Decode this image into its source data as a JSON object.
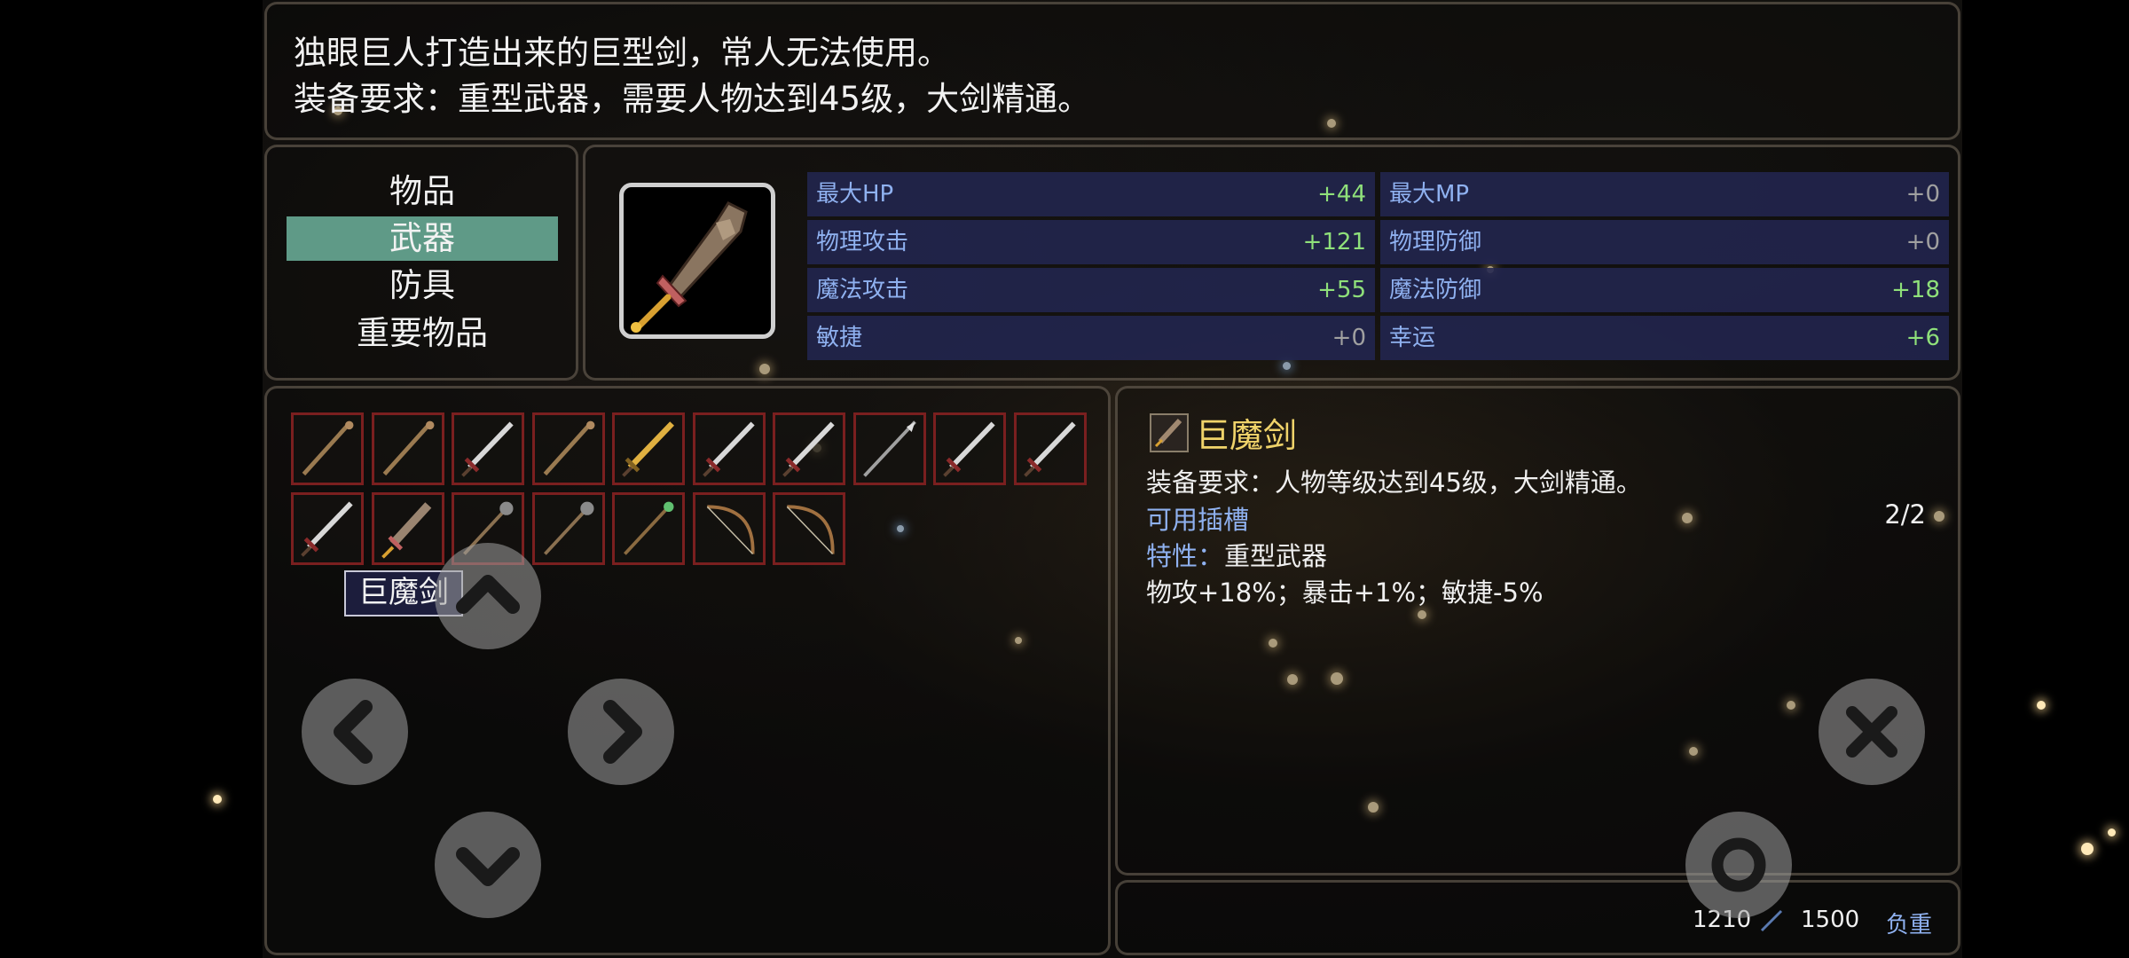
{
  "description": {
    "line1": "独眼巨人打造出来的巨型剑，常人无法使用。",
    "line2": "装备要求：重型武器，需要人物达到45级，大剑精通。"
  },
  "categories": [
    {
      "label": "物品",
      "active": false
    },
    {
      "label": "武器",
      "active": true
    },
    {
      "label": "防具",
      "active": false
    },
    {
      "label": "重要物品",
      "active": false
    }
  ],
  "stats": [
    {
      "left_label": "最大HP",
      "left_value": "+44",
      "right_label": "最大MP",
      "right_value": "+0"
    },
    {
      "left_label": "物理攻击",
      "left_value": "+121",
      "right_label": "物理防御",
      "right_value": "+0"
    },
    {
      "left_label": "魔法攻击",
      "left_value": "+55",
      "right_label": "魔法防御",
      "right_value": "+18"
    },
    {
      "left_label": "敏捷",
      "left_value": "+0",
      "right_label": "幸运",
      "right_value": "+6"
    }
  ],
  "inventory": {
    "items": [
      {
        "icon": "staff-icon"
      },
      {
        "icon": "staff-icon"
      },
      {
        "icon": "sword-icon"
      },
      {
        "icon": "staff-icon"
      },
      {
        "icon": "golden-sword-icon"
      },
      {
        "icon": "sword-icon"
      },
      {
        "icon": "sword-icon"
      },
      {
        "icon": "spear-icon"
      },
      {
        "icon": "sword-icon"
      },
      {
        "icon": "sword-icon"
      },
      {
        "icon": "sword-icon"
      },
      {
        "icon": "greatsword-icon"
      },
      {
        "icon": "mace-icon"
      },
      {
        "icon": "mace-icon"
      },
      {
        "icon": "gem-staff-icon"
      },
      {
        "icon": "bow-icon"
      },
      {
        "icon": "bow-icon"
      }
    ],
    "selected_tooltip": "巨魔剑"
  },
  "detail": {
    "name": "巨魔剑",
    "requirement": "装备要求：人物等级达到45级，大剑精通。",
    "slots_label": "可用插槽",
    "slots_value": "2/2",
    "trait_label": "特性：",
    "trait_value": "重型武器",
    "effects": "物攻+18%；暴击+1%；敏捷-5%"
  },
  "weight": {
    "current": "1210",
    "max": "1500",
    "label": "负重"
  },
  "colors": {
    "active_tab": "#5f9a87",
    "stat_row": "#222650",
    "positive": "#8fe07a",
    "stat_label": "#8fb1f0",
    "item_name": "#f0d36a",
    "slot_border": "#7a1f1f"
  },
  "controls": {
    "up": "chevron-up-icon",
    "left": "chevron-left-icon",
    "right": "chevron-right-icon",
    "down": "chevron-down-icon",
    "close": "close-icon",
    "confirm": "ring-icon"
  }
}
